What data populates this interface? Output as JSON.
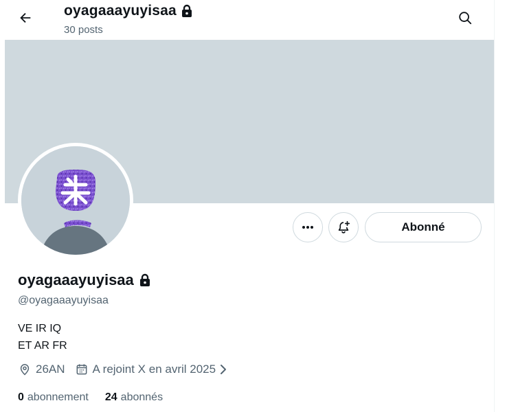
{
  "header": {
    "name": "oyagaaayuyisaa",
    "posts": "30 posts"
  },
  "actions": {
    "follow_label": "Abonné"
  },
  "profile": {
    "display_name": "oyagaaayuyisaa",
    "handle": "@oyagaaayuyisaa",
    "bio_lines": [
      "VE IR IQ",
      "ET AR FR"
    ],
    "location": "26AN",
    "joined": "A rejoint X en avril 2025"
  },
  "stats": {
    "following_count": "0",
    "following_label": "abonnement",
    "followers_count": "24",
    "followers_label": "abonnés"
  },
  "icons": {
    "back": "arrow-left-icon",
    "lock": "lock-icon",
    "search": "search-icon",
    "more": "more-icon",
    "notify": "bell-plus-icon",
    "location": "map-pin-icon",
    "calendar": "calendar-icon",
    "chevron": "chevron-right-icon"
  },
  "colors": {
    "banner": "#cfd9de",
    "secondary_text": "#536471",
    "primary_text": "#0f1419",
    "border": "#cfd9de"
  }
}
